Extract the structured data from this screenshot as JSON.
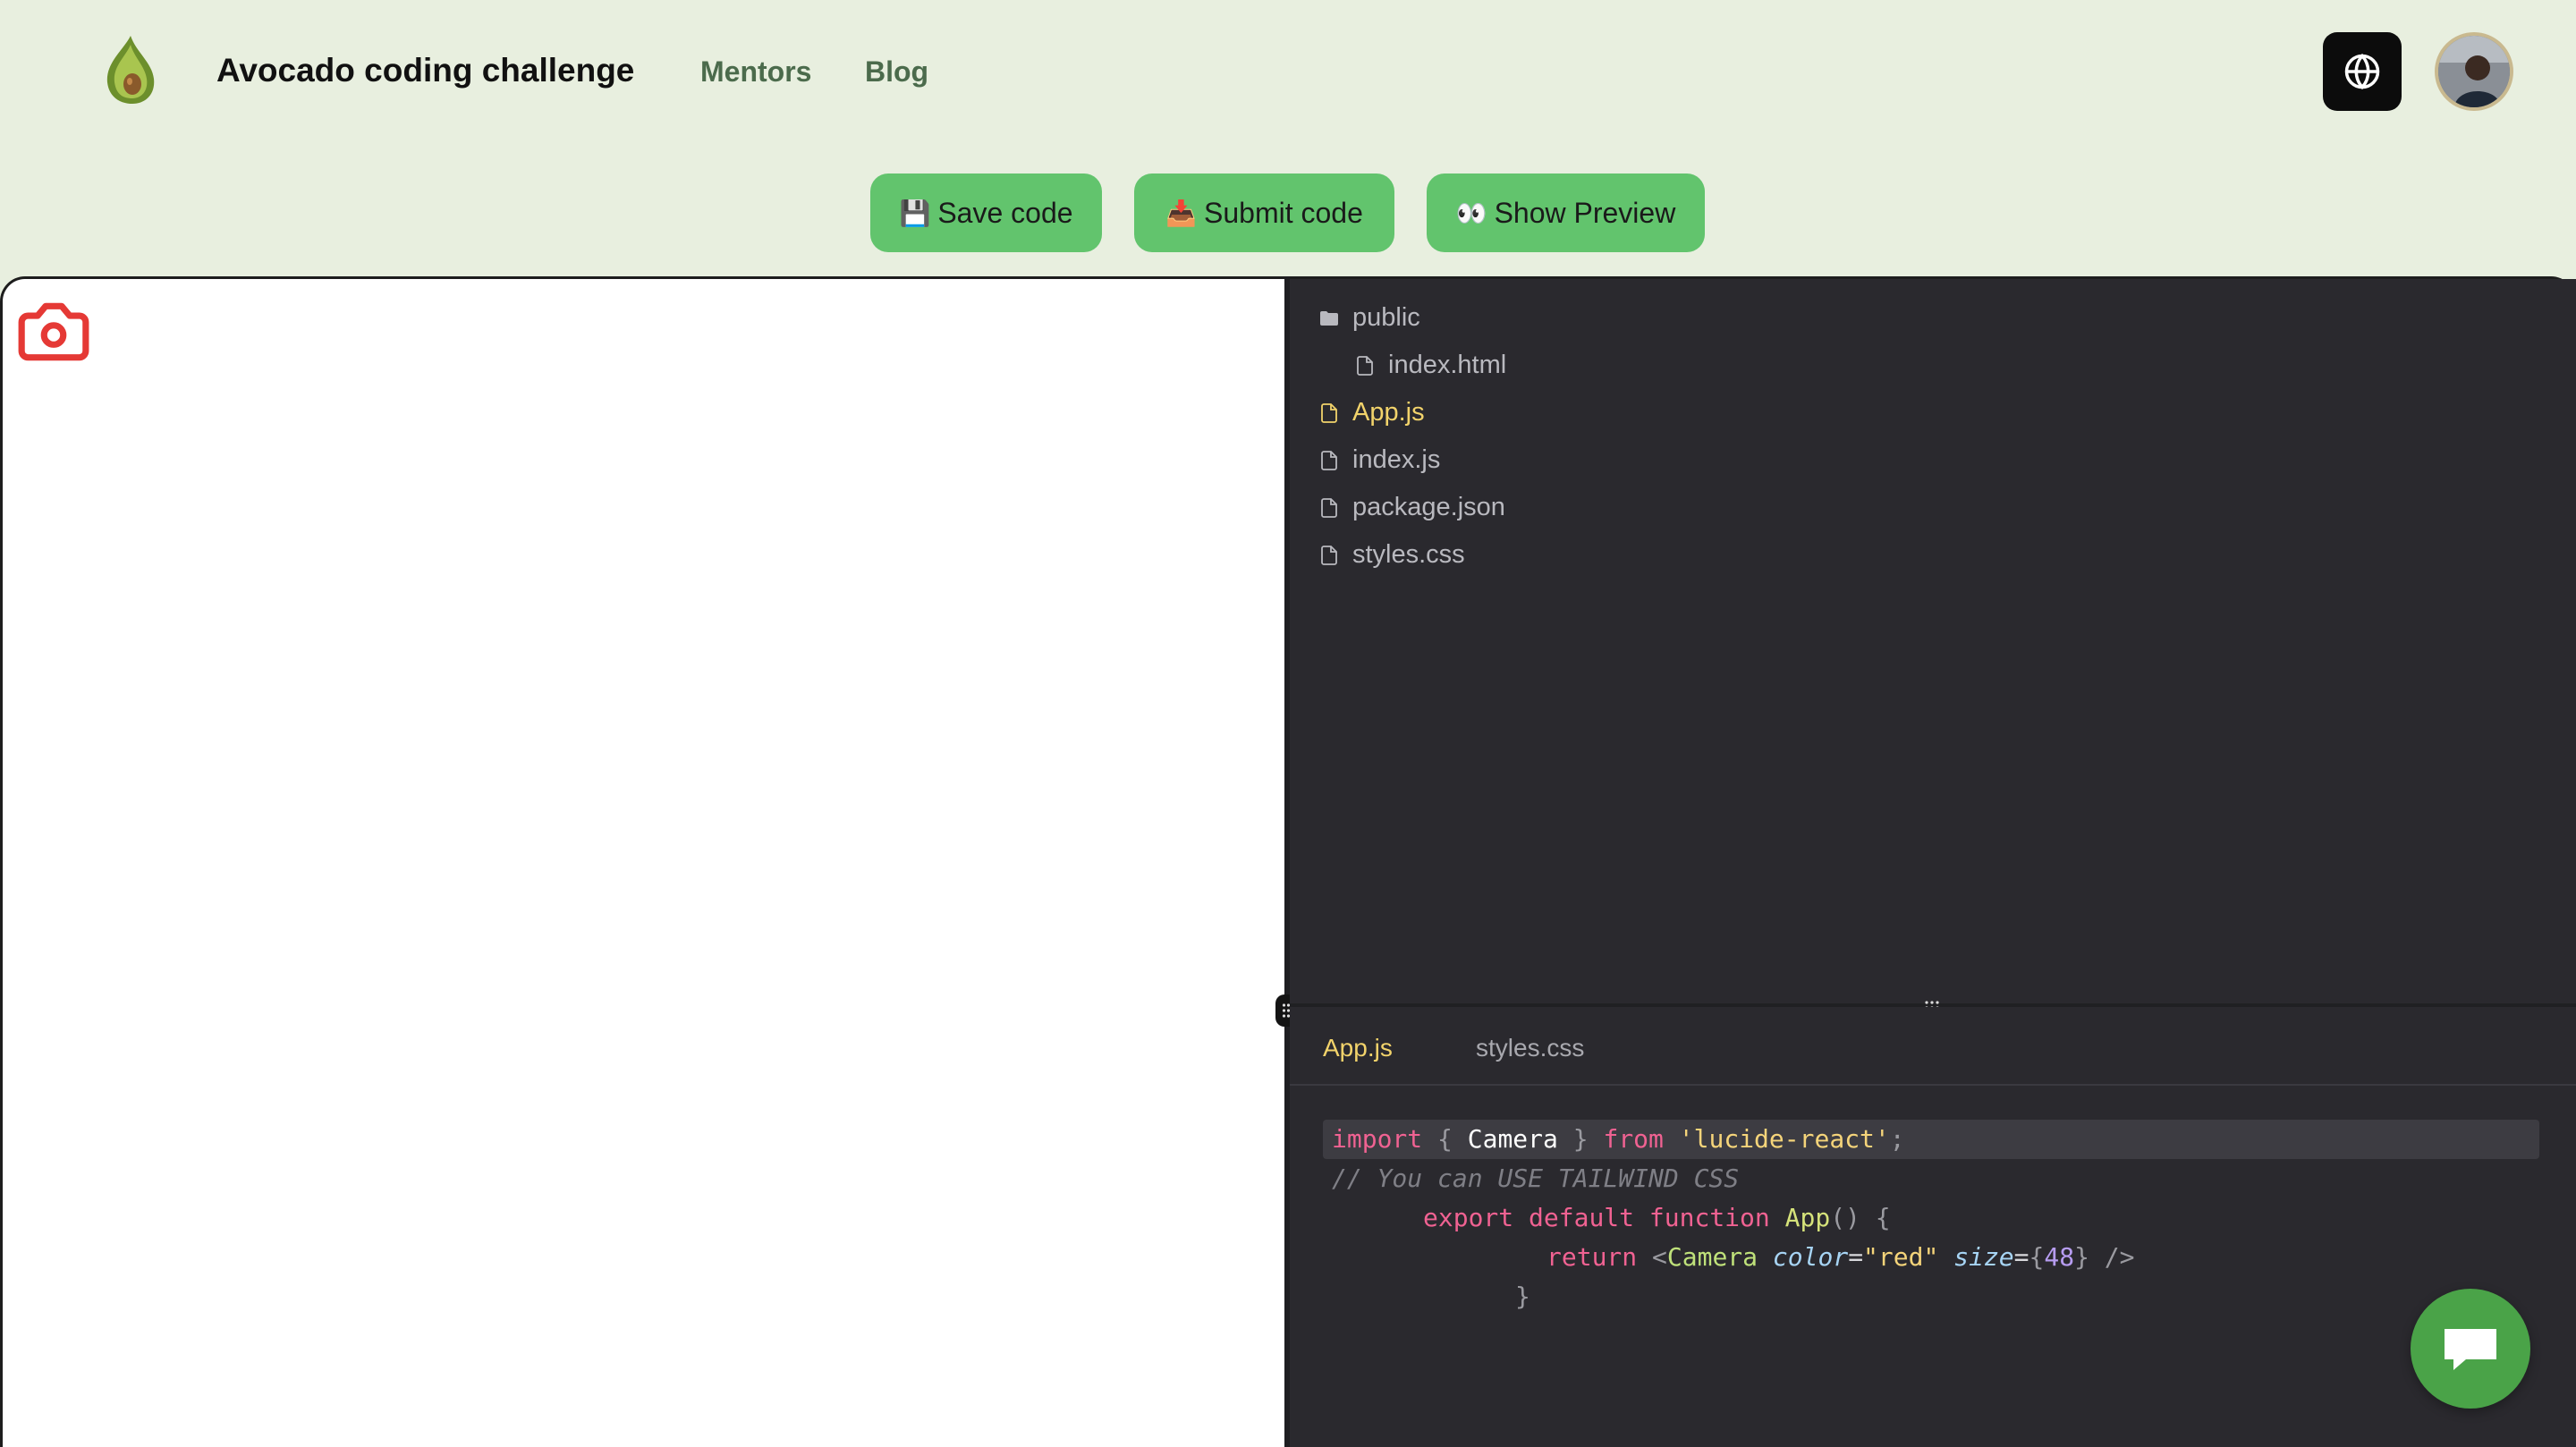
{
  "header": {
    "brand": "Avocado coding challenge",
    "nav": [
      {
        "label": "Mentors"
      },
      {
        "label": "Blog"
      }
    ],
    "logo_icon": "avocado-logo-icon",
    "language_icon": "globe-icon",
    "avatar_icon": "user-avatar"
  },
  "toolbar": {
    "save": {
      "emoji": "💾",
      "label": "Save code"
    },
    "submit": {
      "emoji": "📥",
      "label": "Submit code"
    },
    "preview": {
      "emoji": "👀",
      "label": "Show Preview"
    }
  },
  "preview": {
    "icon": "camera-icon",
    "icon_color": "#e53935"
  },
  "file_tree": {
    "items": [
      {
        "name": "public",
        "type": "folder",
        "icon": "folder-icon"
      },
      {
        "name": "index.html",
        "type": "file",
        "icon": "file-icon"
      },
      {
        "name": "App.js",
        "type": "file",
        "icon": "file-icon",
        "active": true
      },
      {
        "name": "index.js",
        "type": "file",
        "icon": "file-icon"
      },
      {
        "name": "package.json",
        "type": "file",
        "icon": "file-icon"
      },
      {
        "name": "styles.css",
        "type": "file",
        "icon": "file-icon"
      }
    ]
  },
  "editor": {
    "tabs": [
      {
        "label": "App.js",
        "active": true
      },
      {
        "label": "styles.css"
      }
    ],
    "code": {
      "l1": {
        "kw1": "import",
        "p1": " { ",
        "id": "Camera",
        "p2": " } ",
        "kw2": "from",
        "sp": " ",
        "str": "'lucide-react'",
        "p3": ";"
      },
      "l2": {
        "cmt": "// You can USE TAILWIND CSS"
      },
      "l3": {
        "kw1": "export",
        "kw2": "default",
        "kw3": "function",
        "fn": "App",
        "p1": "() {"
      },
      "l4": {
        "kw": "return",
        "p1": "<",
        "tag": "Camera",
        "a1": "color",
        "eq1": "=",
        "s1": "\"red\"",
        "a2": "size",
        "eq2": "=",
        "b1": "{",
        "num": "48",
        "b2": "}",
        "p2": " />"
      },
      "l5": {
        "p": "}"
      }
    }
  },
  "colors": {
    "accent_green": "#62c46d",
    "active_file": "#f2d36b",
    "chat_green": "#4aa348"
  },
  "chat": {
    "icon": "chat-bubble-icon"
  }
}
